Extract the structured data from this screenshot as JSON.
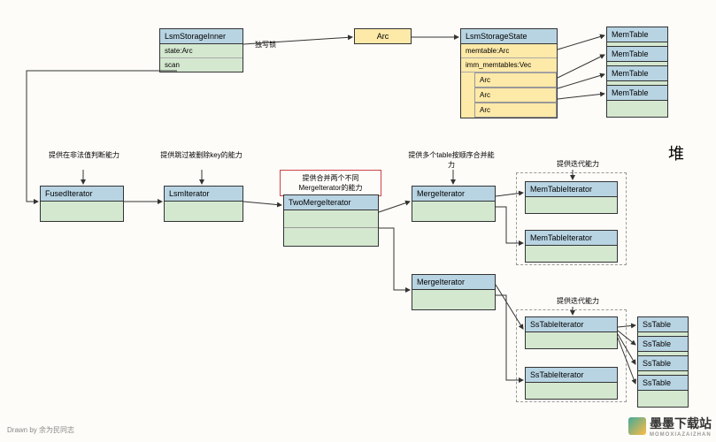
{
  "nodes": {
    "lsmStorageInner": {
      "title": "LsmStorageInner",
      "rows": [
        "state:Arc",
        "scan"
      ]
    },
    "arc": {
      "title": "Arc"
    },
    "lsmStorageState": {
      "title": "LsmStorageState",
      "rows": [
        "memtable:Arc",
        "imm_memtables:Vec",
        "Arc",
        "Arc",
        "Arc"
      ]
    },
    "memTable1": "MemTable",
    "memTable2": "MemTable",
    "memTable3": "MemTable",
    "memTable4": "MemTable",
    "fusedIterator": "FusedIterator",
    "lsmIterator": "LsmIterator",
    "twoMergeIterator": "TwoMergeIterator",
    "mergeIterator1": "MergeIterator",
    "mergeIterator2": "MergeIterator",
    "memTableIterator1": "MemTableIterator",
    "memTableIterator2": "MemTableIterator",
    "ssTableIterator1": "SsTableIterator",
    "ssTableIterator2": "SsTableIterator",
    "ssTable1": "SsTable",
    "ssTable2": "SsTable",
    "ssTable3": "SsTable",
    "ssTable4": "SsTable"
  },
  "labels": {
    "exclusiveLock": "独写锁",
    "fusedDesc": "提供在非法值判断能力",
    "lsmIterDesc": "提供跳过被删除key的能力",
    "twoMergeDesc": "提供合并两个不同MergeIterator的能力",
    "mergeDesc": "提供多个table按顺序合并能力",
    "iterDesc1": "提供迭代能力",
    "iterDesc2": "提供迭代能力",
    "heap": "堆"
  },
  "footer": "Drawn by  余为民同志",
  "watermark": {
    "text": "墨墨下载站",
    "sub": "MOMOXIAZAIZHAN"
  }
}
